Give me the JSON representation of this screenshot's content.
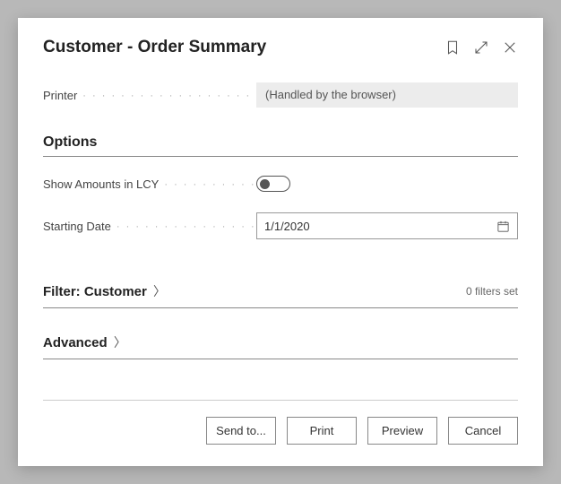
{
  "dialog": {
    "title": "Customer - Order Summary"
  },
  "printer": {
    "label": "Printer",
    "value": "(Handled by the browser)"
  },
  "sections": {
    "options": "Options",
    "filter_customer": "Filter: Customer",
    "advanced": "Advanced"
  },
  "options": {
    "show_amounts_lcy": {
      "label": "Show Amounts in LCY",
      "enabled": false
    },
    "starting_date": {
      "label": "Starting Date",
      "value": "1/1/2020"
    }
  },
  "filter": {
    "hint": "0 filters set"
  },
  "buttons": {
    "send_to": "Send to...",
    "print": "Print",
    "preview": "Preview",
    "cancel": "Cancel"
  }
}
